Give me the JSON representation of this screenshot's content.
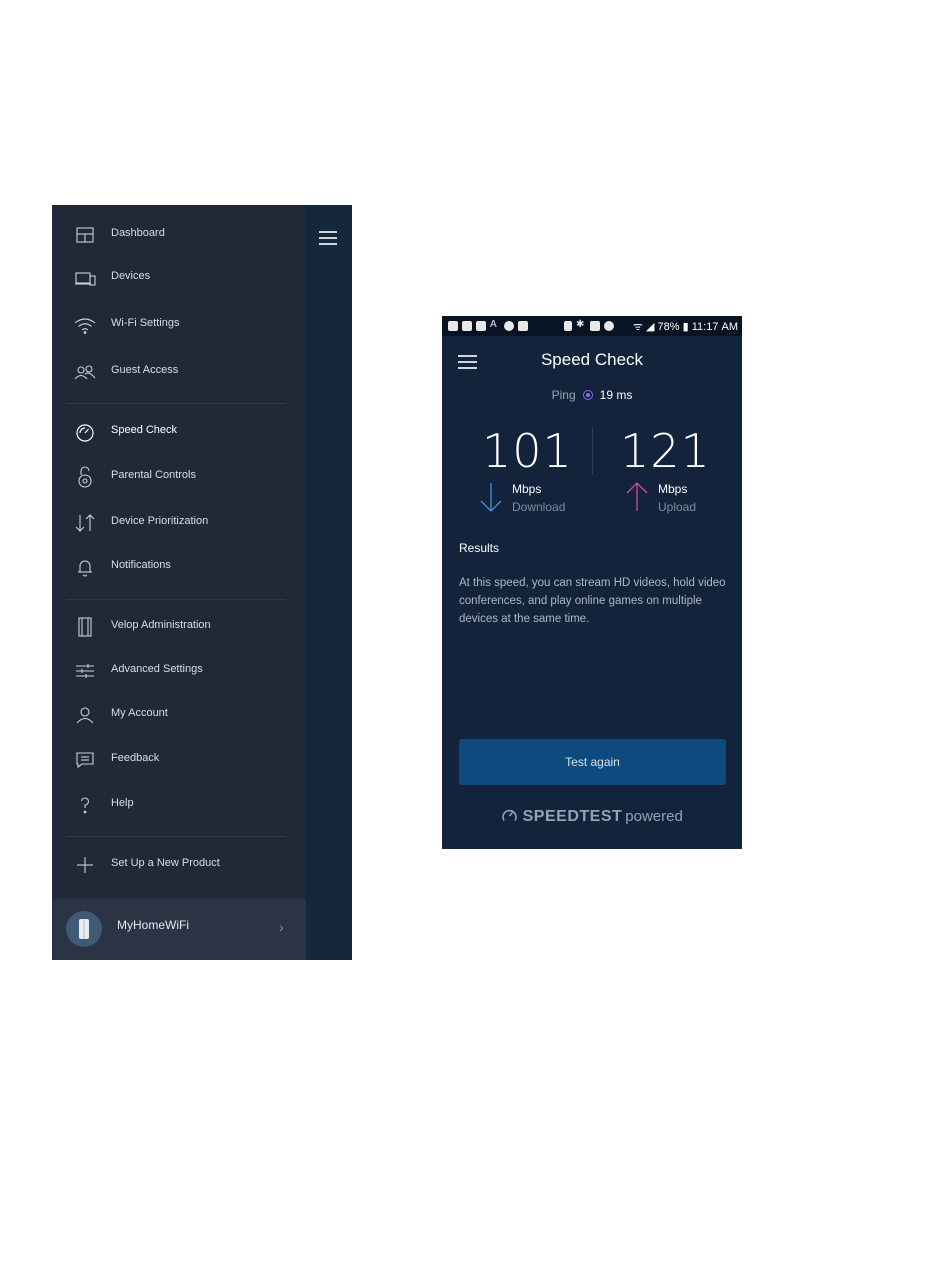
{
  "nav": {
    "items": [
      {
        "label": "Dashboard",
        "icon": "dashboard-icon"
      },
      {
        "label": "Devices",
        "icon": "devices-icon"
      },
      {
        "label": "Wi-Fi Settings",
        "icon": "wifi-icon"
      },
      {
        "label": "Guest Access",
        "icon": "guest-icon"
      },
      {
        "label": "Speed Check",
        "icon": "speedometer-icon",
        "active": true
      },
      {
        "label": "Parental Controls",
        "icon": "lock-icon"
      },
      {
        "label": "Device Prioritization",
        "icon": "priority-arrows-icon"
      },
      {
        "label": "Notifications",
        "icon": "bell-icon"
      },
      {
        "label": "Velop Administration",
        "icon": "velop-node-icon"
      },
      {
        "label": "Advanced Settings",
        "icon": "sliders-icon"
      },
      {
        "label": "My Account",
        "icon": "user-icon"
      },
      {
        "label": "Feedback",
        "icon": "chat-icon"
      },
      {
        "label": "Help",
        "icon": "question-icon"
      },
      {
        "label": "Set Up a New Product",
        "icon": "plus-icon"
      }
    ],
    "network_name": "MyHomeWiFi"
  },
  "phone": {
    "status_bar": {
      "battery": "78%",
      "time": "11:17 AM"
    },
    "title": "Speed Check",
    "ping_label": "Ping",
    "ping_value": "19 ms",
    "download": {
      "value": "101",
      "unit": "Mbps",
      "label": "Download"
    },
    "upload": {
      "value": "121",
      "unit": "Mbps",
      "label": "Upload"
    },
    "results_heading": "Results",
    "results_text": "At this speed, you can stream HD videos, hold video conferences, and play online games on multiple devices at the same time.",
    "button_label": "Test again",
    "brand": {
      "speedtest": "SPEEDTEST",
      "powered": "powered"
    }
  },
  "colors": {
    "drawer_bg": "#212939",
    "phone_bg": "#13233c",
    "button_bg": "#0e4a7d",
    "download_arrow": "#4a90d9",
    "upload_arrow": "#d04aa8",
    "ping_accent": "#8c6cf0"
  }
}
